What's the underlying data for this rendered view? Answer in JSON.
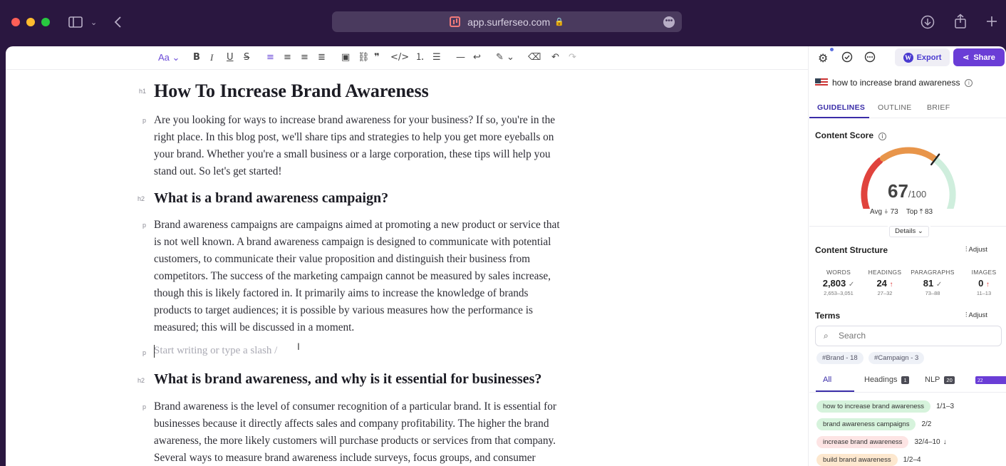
{
  "browser": {
    "url": "app.surferseo.com"
  },
  "toolbar": {
    "font_size_label": "Aa"
  },
  "document": {
    "h1": {
      "tag": "h1",
      "text": "How To Increase Brand Awareness"
    },
    "p1": {
      "tag": "p",
      "lines": [
        "Are you looking for ways to increase brand awareness for your business? If so, you're in the",
        "right place. In this blog post, we'll share tips and strategies to help you get more eyeballs on",
        "your brand. Whether you're a small business or a large corporation, these tips will help you",
        "stand out. So let's get started!"
      ]
    },
    "h2a": {
      "tag": "h2",
      "text": "What is a brand awareness campaign?"
    },
    "p2": {
      "tag": "p",
      "lines": [
        "Brand awareness campaigns are campaigns aimed at promoting a new product or service that",
        "is not well known. A brand awareness campaign is designed to communicate with potential",
        "customers, to communicate their value proposition and distinguish their business from",
        "competitors. The success of the marketing campaign cannot be measured by sales increase,",
        "though this is likely factored in. It primarily aims to increase the knowledge of brands",
        "products to target audiences; it is possible by various measures how the performance is",
        "measured; this will be discussed in a moment."
      ]
    },
    "placeholder": {
      "tag": "p",
      "text": "Start writing or type a slash /"
    },
    "h2b": {
      "tag": "h2",
      "text": "What is brand awareness, and why is it essential for businesses?"
    },
    "p3": {
      "tag": "p",
      "lines": [
        "Brand awareness is the level of consumer recognition of a particular brand. It is essential for",
        "businesses because it directly affects sales and company profitability. The higher the brand",
        "awareness, the more likely customers will purchase products or services from that company.",
        "Several ways to measure brand awareness include surveys, focus groups, and consumer"
      ]
    }
  },
  "sidebar": {
    "export_label": "Export",
    "share_label": "Share",
    "keyword": "how to increase brand awareness",
    "tabs": [
      "GUIDELINES",
      "OUTLINE",
      "BRIEF"
    ],
    "content_score": {
      "title": "Content Score",
      "score": 67,
      "max": "/100",
      "avg_label": "Avg",
      "avg": "73",
      "top_label": "Top",
      "top": "83",
      "details_label": "Details"
    },
    "structure": {
      "title": "Content Structure",
      "adjust_label": "Adjust",
      "stats": [
        {
          "label": "WORDS",
          "value": "2,803",
          "range": "2,653–3,051",
          "indicator": "check"
        },
        {
          "label": "HEADINGS",
          "value": "24",
          "range": "27–32",
          "indicator": "up"
        },
        {
          "label": "PARAGRAPHS",
          "value": "81",
          "range": "73–88",
          "indicator": "check"
        },
        {
          "label": "IMAGES",
          "value": "0",
          "range": "11–13",
          "indicator": "up"
        }
      ]
    },
    "terms": {
      "title": "Terms",
      "adjust_label": "Adjust",
      "search_placeholder": "Search",
      "chips": [
        "#Brand - 18",
        "#Campaign - 3"
      ],
      "filters": [
        {
          "label": "All",
          "count": "22"
        },
        {
          "label": "Headings",
          "count": "1"
        },
        {
          "label": "NLP",
          "count": "20"
        }
      ],
      "items": [
        {
          "text": "how to increase brand awareness",
          "count": "1/1–3",
          "color": "#d6f3dc",
          "arrow": ""
        },
        {
          "text": "brand awareness campaigns",
          "count": "2/2",
          "color": "#d6f3dc",
          "arrow": ""
        },
        {
          "text": "increase brand awareness",
          "count": "32/4–10",
          "color": "#fde4e4",
          "arrow": "↓"
        },
        {
          "text": "build brand awareness",
          "count": "1/2–4",
          "color": "#fde8cf",
          "arrow": ""
        }
      ]
    },
    "colors": {
      "accent": "#6a3dd6",
      "gauge_red": "#e0433d",
      "gauge_orange": "#e8954a",
      "gauge_green": "#cfeedd"
    }
  }
}
